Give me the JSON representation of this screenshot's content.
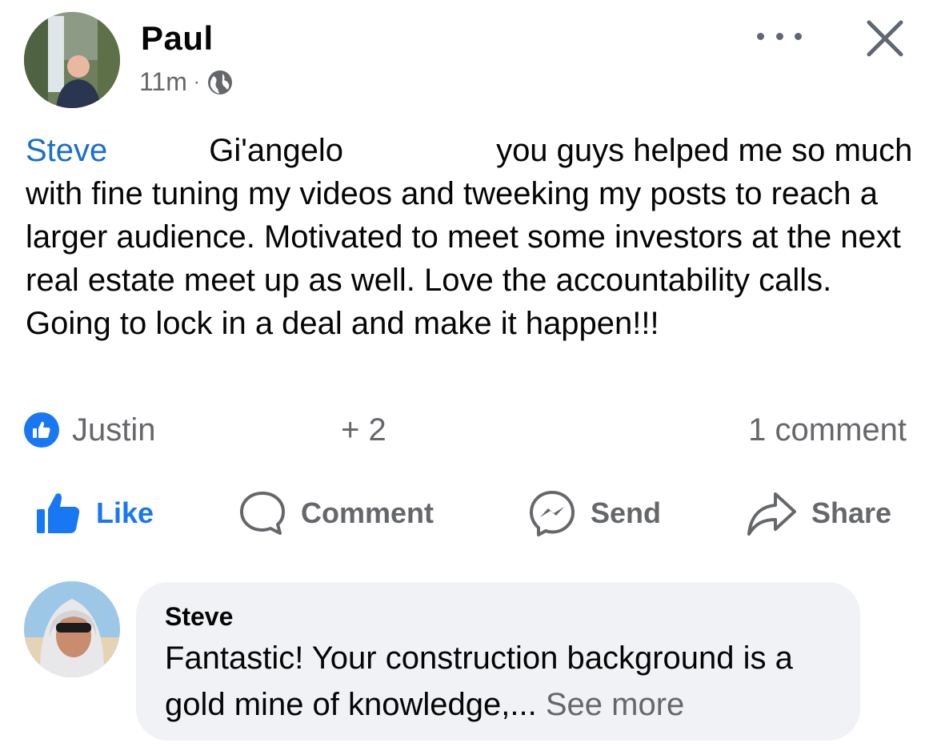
{
  "post": {
    "author": "Paul",
    "time": "11m",
    "separator": "·",
    "privacy_icon": "globe-icon",
    "body": {
      "mention_1": "Steve",
      "mention_2": "Gi'angelo",
      "text_line_1": "you guys helped me so",
      "text_rest": "much with fine tuning my videos and tweeking my posts to reach a larger audience.  Motivated to meet some investors at the next real estate meet up as well.  Love the accountability calls. Going to lock in a deal and make it happen!!!"
    }
  },
  "reactions": {
    "icon": "like-reaction-icon",
    "name": "Justin",
    "extra": "+ 2",
    "comment_count": "1 comment"
  },
  "actions": {
    "like": "Like",
    "comment": "Comment",
    "send": "Send",
    "share": "Share"
  },
  "comment": {
    "author": "Steve",
    "text": "Fantastic! Your construction background is a gold mine of knowledge,...",
    "see_more": "See more"
  },
  "colors": {
    "accent": "#1877f2",
    "mention": "#1b6fc9",
    "secondary_text": "#65676b",
    "bubble": "#f0f2f5"
  }
}
